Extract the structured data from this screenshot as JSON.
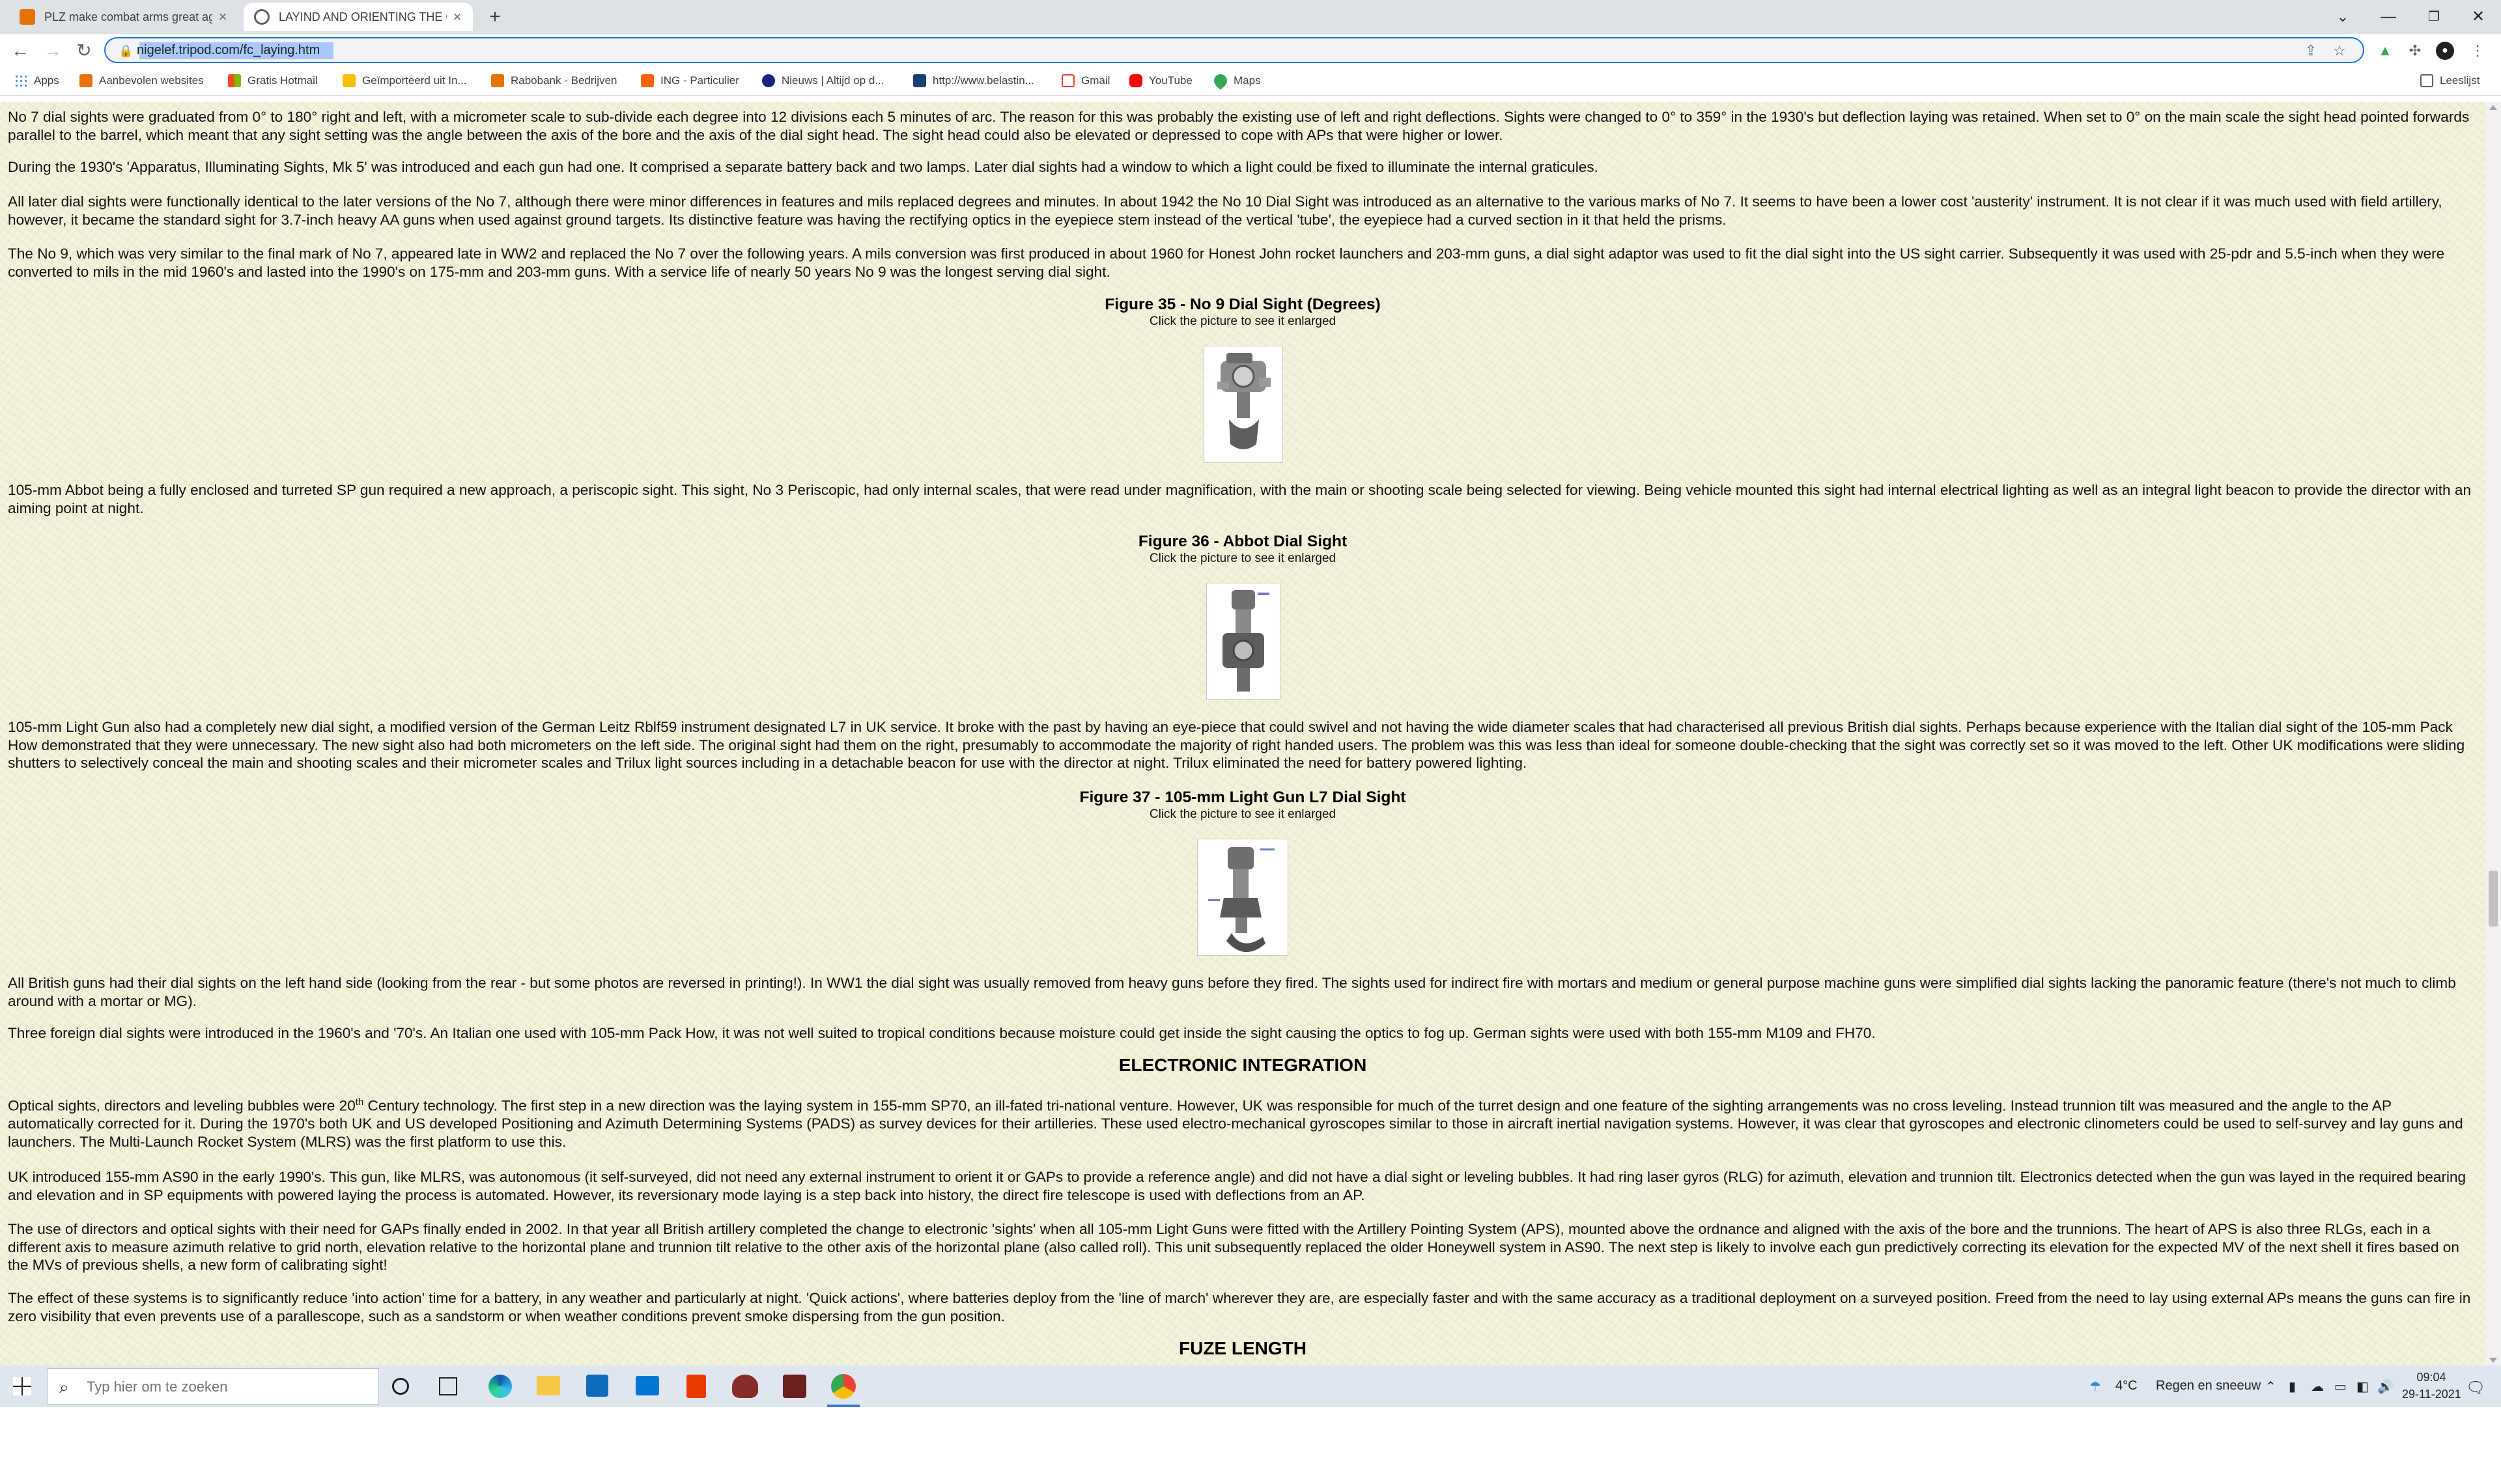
{
  "browser": {
    "tabs": [
      {
        "title": "PLZ make combat arms great ag",
        "color": "#e37400"
      },
      {
        "title": "LAYIND AND ORIENTING THE GU",
        "color": "#5f6368"
      }
    ],
    "new_tab": "+",
    "url": "nigelef.tripod.com/fc_laying.htm",
    "bookmarks": [
      {
        "label": "Apps",
        "color": "#4285f4"
      },
      {
        "label": "Aanbevolen websites",
        "color": "#e8710a"
      },
      {
        "label": "Gratis Hotmail",
        "color": "#34a853"
      },
      {
        "label": "Geïmporteerd uit In...",
        "color": "#fbbc04"
      },
      {
        "label": "Rabobank - Bedrijven",
        "color": "#e37400"
      },
      {
        "label": "ING - Particulier",
        "color": "#ff6200"
      },
      {
        "label": "Nieuws | Altijd op d...",
        "color": "#1a237e"
      },
      {
        "label": "http://www.belastin...",
        "color": "#154273"
      },
      {
        "label": "Gmail",
        "color": "#ea4335"
      },
      {
        "label": "YouTube",
        "color": "#ff0000"
      },
      {
        "label": "Maps",
        "color": "#34a853"
      }
    ],
    "reading_list": "Leeslijst"
  },
  "article": {
    "p1": "No 7 dial sights were graduated from 0° to 180° right and left, with a micrometer scale to sub-divide each degree into 12 divisions each 5 minutes of arc.  The reason for this was probably the existing use of left and right deflections.  Sights were changed to 0° to 359° in the 1930's but deflection laying was retained.  When set to 0° on the main scale the sight head pointed forwards parallel to the barrel, which meant that any sight setting was the angle between the axis of the bore and the axis of the dial sight head.  The sight head could also be elevated or depressed to cope with APs that were higher or lower.",
    "p2": "During the 1930's 'Apparatus, Illuminating Sights, Mk 5' was introduced and each gun had one.  It comprised a separate battery back and two lamps.  Later dial sights had a window to which a light could be fixed to illuminate the internal graticules.",
    "p3": "All later dial sights were functionally identical to the later versions of the No 7, although there were minor differences in features and mils replaced degrees and minutes.  In about 1942 the No 10 Dial Sight was introduced as an alternative to the various marks of No 7.  It seems to have been a lower cost 'austerity' instrument.  It is not clear if it was much used with field artillery, however, it became the standard sight for 3.7-inch heavy AA guns when used against ground targets.  Its distinctive feature was having the rectifying optics in the eyepiece stem instead of the vertical 'tube', the eyepiece had a curved section in it that held the prisms.",
    "p4": "The No 9, which was very similar to the final mark of No 7, appeared late in WW2 and replaced the No 7 over the following years.  A mils conversion was first produced in about 1960 for Honest John rocket launchers and 203-mm guns, a dial sight adaptor was used to fit the dial sight into the US sight carrier.  Subsequently it was used with 25-pdr and 5.5-inch when they were converted to mils in the mid 1960's and lasted into the 1990's on 175-mm and 203-mm guns.  With a service life of nearly 50 years No 9 was the longest serving dial sight.",
    "fig35_title": "Figure 35 - No 9 Dial Sight (Degrees)",
    "fig35_hint": "Click the picture to see it enlarged",
    "p5": "105-mm Abbot being a fully enclosed and turreted SP gun required a new approach, a periscopic sight.  This sight, No 3 Periscopic, had only internal scales, that were read under magnification, with the main or shooting scale being selected for viewing.  Being vehicle mounted this sight had internal electrical lighting as well as an integral light beacon to provide the director with an aiming point at night.",
    "fig36_title": "Figure 36 - Abbot Dial Sight",
    "fig36_hint": "Click the picture to see it enlarged",
    "p6": "105-mm Light Gun also had a completely new dial sight, a modified version of the German Leitz Rblf59 instrument designated L7 in UK service.  It broke with the past by having an eye-piece that could swivel and not having the wide diameter scales that had characterised all previous British dial sights.  Perhaps because experience with the Italian dial sight of the 105-mm Pack How demonstrated that they were unnecessary.  The new sight also had both micrometers on the left side.  The original sight had them on the right, presumably to accommodate the majority of right handed users.  The problem was  this was less than ideal for someone double-checking that the sight was correctly set so it was moved to the left.  Other UK modifications were sliding shutters to selectively conceal the main and shooting scales and their micrometer scales and Trilux light sources including in a detachable beacon for use with the director at night.  Trilux eliminated the need for battery powered lighting.",
    "fig37_title": "Figure 37 - 105-mm Light Gun L7 Dial Sight",
    "fig37_hint": "Click the picture to see it enlarged",
    "p7": "All British guns had their dial sights on the left hand side (looking from the rear - but some photos are reversed in printing!).  In WW1 the dial sight was usually removed from heavy guns before they fired.  The sights used for indirect fire with mortars and medium or general purpose machine guns were simplified dial sights lacking the panoramic feature (there's not much to climb around with a mortar or MG).",
    "p8": "Three foreign dial sights were introduced in the 1960's and '70's.  An Italian one used with 105-mm Pack How, it was not well suited to tropical conditions because moisture could get inside the sight causing the optics to fog up.  German sights were used with both 155-mm M109 and FH70.",
    "h_electronic": "ELECTRONIC INTEGRATION",
    "p9_a": "Optical sights, directors and leveling bubbles were 20",
    "p9_sup": "th",
    "p9_b": " Century technology.  The first step in a new direction was the laying system in 155-mm SP70, an ill-fated tri-national venture.  However, UK was responsible for much of the turret design and one feature of the sighting arrangements was no cross leveling.  Instead trunnion tilt was measured and the angle to the AP automatically corrected for it.  During the 1970's both UK and US developed Positioning and Azimuth Determining Systems (PADS) as survey devices for their artilleries.  These used electro-mechanical gyroscopes similar to those in aircraft inertial navigation systems.  However, it was clear that gyroscopes and electronic clinometers could be used to self-survey and lay guns and launchers.  The Multi-Launch Rocket System (MLRS) was the first platform to use this.",
    "p10": "UK introduced 155-mm AS90 in the early 1990's.  This gun, like MLRS, was autonomous (it self-surveyed, did not need any external instrument to orient it or GAPs to provide a reference angle) and did not have a dial sight or leveling bubbles.  It had ring laser gyros (RLG) for azimuth,  elevation and trunnion tilt.  Electronics detected when the gun was layed in the required bearing and elevation and in SP equipments with powered laying the process is automated.  However, its reversionary mode laying is a step back into history, the direct fire telescope is used with deflections from an AP.",
    "p11": "The use of directors and optical sights with their need for GAPs finally ended in 2002.  In that year all British artillery completed the change to electronic 'sights' when all 105-mm Light Guns were fitted with the Artillery Pointing System (APS), mounted above the ordnance and aligned with the axis of the bore and the trunnions.   The heart of APS is also three RLGs, each in a different axis to measure azimuth relative to grid north, elevation relative to the horizontal plane and trunnion tilt relative to the other axis of the horizontal plane (also called roll).   This unit subsequently replaced the older Honeywell system in AS90.  The next step is likely to involve each gun predictively correcting its elevation for the expected MV of the next shell it fires based on the MVs of previous shells, a new form of calibrating sight!",
    "p12": "The effect of these systems is to significantly reduce 'into action' time for a battery, in any weather and particularly at night.  'Quick actions', where batteries deploy from the 'line of march' wherever they are, are especially faster and with the same accuracy as a traditional deployment on a surveyed position.  Freed from the need to lay using external APs means the guns can fire in zero visibility that even prevents use of a parallescope, such as a sandstorm or when weather conditions prevent smoke dispersing from the gun position.",
    "h_fuze": "FUZE LENGTH"
  },
  "scroll": {
    "thumb_fraction_top": 0.61,
    "thumb_fraction_size": 0.045
  },
  "taskbar": {
    "search_placeholder": "Typ hier om te zoeken",
    "temperature": "4°C",
    "weather": "Regen en sneeuw",
    "time": "09:04",
    "date": "29-11-2021"
  }
}
